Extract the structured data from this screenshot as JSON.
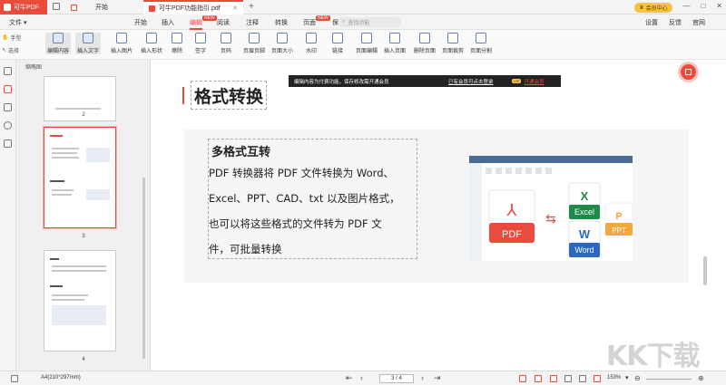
{
  "app": {
    "logo_text": "可牛PDF"
  },
  "tabs": [
    {
      "label": "开始"
    },
    {
      "label": "可牛PDF功能指引.pdf"
    }
  ],
  "vip_button": "会员中心",
  "window_controls": [
    "—",
    "□",
    "✕"
  ],
  "menu": {
    "file": "文件",
    "items": [
      "开始",
      "插入",
      "编辑",
      "阅读",
      "注释",
      "转换",
      "页面",
      "保护"
    ],
    "new_badge": "NEW",
    "search_placeholder": "查找功能",
    "right": [
      "设置",
      "反馈",
      "官网"
    ]
  },
  "toolbar": {
    "hand": "手型",
    "select": "选择",
    "items": [
      "编辑内容",
      "插入文字",
      "插入图片",
      "插入形状",
      "擦除",
      "签字",
      "页码",
      "页眉页脚",
      "页面大小",
      "水印",
      "链接",
      "页面编辑",
      "插入页面",
      "删除页面",
      "页面裁剪",
      "页面分割"
    ]
  },
  "thumbnails": {
    "header": "缩略图",
    "page_numbers": [
      "2",
      "3",
      "4"
    ]
  },
  "banner": {
    "text": "编辑内容为付费功能，保存修改需开通会员",
    "link": "已有会员可点击登录",
    "vip": "VIP",
    "open": "开通会员"
  },
  "document": {
    "title": "格式转换",
    "heading": "多格式互转",
    "lines": [
      "PDF 转换器将 PDF 文件转换为 Word、",
      "Excel、PPT、CAD、txt 以及图片格式，",
      "也可以将这些格式的文件转为 PDF 文",
      "件，可批量转换"
    ],
    "illustration_labels": {
      "pdf": "PDF",
      "excel_letter": "X",
      "excel": "Excel",
      "word_letter": "W",
      "word": "Word",
      "ppt_letter": "P",
      "ppt": "PPT"
    }
  },
  "status": {
    "page_size": "A4(210*297mm)",
    "page_indicator": "3 / 4",
    "zoom": "153%"
  },
  "watermark": "KK下载",
  "colors": {
    "accent": "#e94b3c",
    "excel": "#1e8a4a",
    "word": "#2a68c4",
    "ppt": "#f2a93b",
    "pdf": "#e94b3c"
  }
}
